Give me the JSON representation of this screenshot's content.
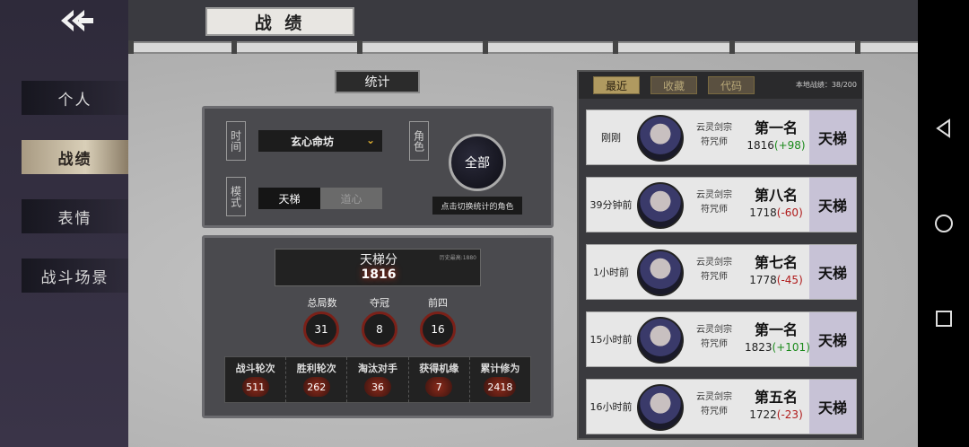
{
  "sidebar": {
    "items": [
      {
        "label": "个人",
        "active": false
      },
      {
        "label": "战绩",
        "active": true
      },
      {
        "label": "表情",
        "active": false
      },
      {
        "label": "战斗场景",
        "active": false
      }
    ]
  },
  "header": {
    "title": "战 绩"
  },
  "stats": {
    "tab_label": "统计",
    "time_label": "时间",
    "season_value": "玄心命坊",
    "mode_label": "模式",
    "mode_options": [
      "天梯",
      "道心"
    ],
    "role_label": "角色",
    "all_button": "全部",
    "switch_hint": "点击切换统计的角色"
  },
  "score": {
    "ladder_title": "天梯分",
    "ladder_best": "历史最高:1880",
    "ladder_value": "1816",
    "summary": [
      {
        "label": "总局数",
        "value": "31"
      },
      {
        "label": "夺冠",
        "value": "8"
      },
      {
        "label": "前四",
        "value": "16"
      }
    ],
    "details": [
      {
        "label": "战斗轮次",
        "value": "511"
      },
      {
        "label": "胜利轮次",
        "value": "262"
      },
      {
        "label": "淘汰对手",
        "value": "36"
      },
      {
        "label": "获得机缘",
        "value": "7"
      },
      {
        "label": "累计修为",
        "value": "2418"
      }
    ]
  },
  "records": {
    "tabs": [
      {
        "label": "最近",
        "active": true
      },
      {
        "label": "收藏",
        "active": false
      },
      {
        "label": "代码",
        "active": false
      }
    ],
    "local_count": "本地战绩：38/200",
    "matches": [
      {
        "time": "刚刚",
        "sect": "云灵剑宗",
        "role": "符咒师",
        "rank": "第一名",
        "score": "1816",
        "delta": "(+98)",
        "positive": true,
        "mode": "天梯"
      },
      {
        "time": "39分钟前",
        "sect": "云灵剑宗",
        "role": "符咒师",
        "rank": "第八名",
        "score": "1718",
        "delta": "(-60)",
        "positive": false,
        "mode": "天梯"
      },
      {
        "time": "1小时前",
        "sect": "云灵剑宗",
        "role": "符咒师",
        "rank": "第七名",
        "score": "1778",
        "delta": "(-45)",
        "positive": false,
        "mode": "天梯"
      },
      {
        "time": "15小时前",
        "sect": "云灵剑宗",
        "role": "符咒师",
        "rank": "第一名",
        "score": "1823",
        "delta": "(+101)",
        "positive": true,
        "mode": "天梯"
      },
      {
        "time": "16小时前",
        "sect": "云灵剑宗",
        "role": "符咒师",
        "rank": "第五名",
        "score": "1722",
        "delta": "(-23)",
        "positive": false,
        "mode": "天梯"
      }
    ]
  },
  "icons": {
    "back": "double-chevron-left-icon",
    "nav_back": "triangle-back-icon",
    "nav_home": "circle-home-icon",
    "nav_recent": "square-recent-icon"
  },
  "colors": {
    "accent_gold": "#b09a60",
    "positive": "#1a8a1a",
    "negative": "#b01a1a",
    "mode_badge": "#c7c2d6"
  }
}
